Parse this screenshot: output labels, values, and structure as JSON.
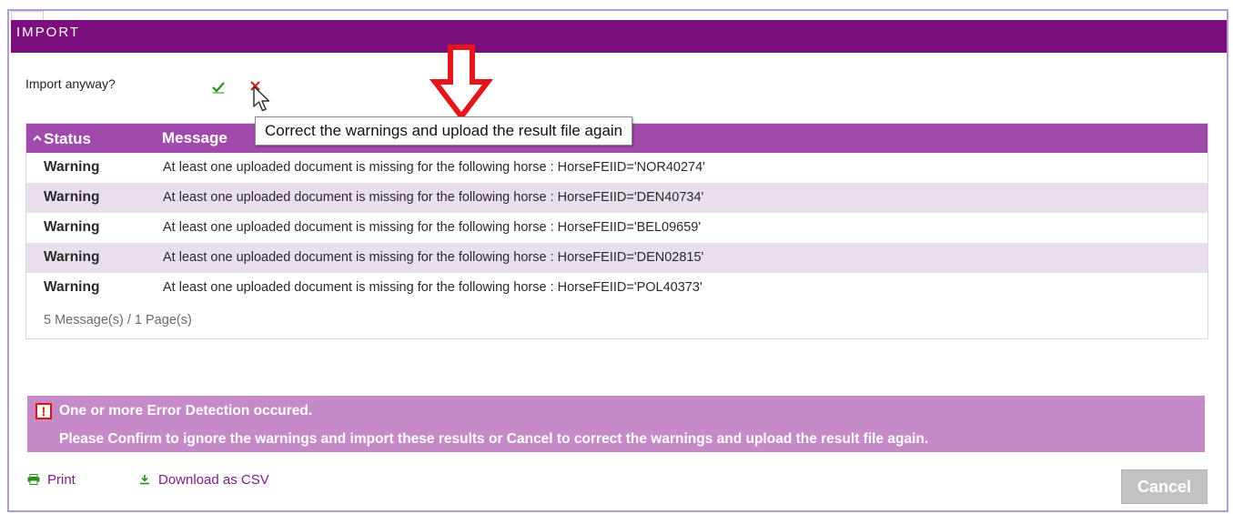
{
  "dialog": {
    "title": "IMPORT"
  },
  "import_prompt": {
    "label": "Import anyway?",
    "confirm_icon": "checkmark-icon",
    "reject_icon": "x-icon"
  },
  "tooltip": {
    "text": "Correct the warnings and upload the result file again"
  },
  "annotation": {
    "icon": "down-arrow-icon",
    "color": "#e3161b"
  },
  "grid": {
    "columns": [
      "Status",
      "Message"
    ],
    "sort_icon": "sort-up-icon",
    "rows": [
      {
        "status": "Warning",
        "message": "At least one uploaded document is missing for the following horse : HorseFEIID='NOR40274'"
      },
      {
        "status": "Warning",
        "message": "At least one uploaded document is missing for the following horse : HorseFEIID='DEN40734'"
      },
      {
        "status": "Warning",
        "message": "At least one uploaded document is missing for the following horse : HorseFEIID='BEL09659'"
      },
      {
        "status": "Warning",
        "message": "At least one uploaded document is missing for the following horse : HorseFEIID='DEN02815'"
      },
      {
        "status": "Warning",
        "message": "At least one uploaded document is missing for the following horse : HorseFEIID='POL40373'"
      }
    ],
    "footer": "5 Message(s) / 1 Page(s)"
  },
  "error_banner": {
    "icon": "exclamation-icon",
    "icon_glyph": "!",
    "line1": "One or more Error Detection occured.",
    "line2": "Please Confirm to ignore the warnings and import these results or Cancel to correct the warnings and upload the result file again."
  },
  "actions": {
    "print_label": "Print",
    "print_icon": "printer-icon",
    "csv_label": "Download as CSV",
    "csv_icon": "download-icon",
    "cancel_label": "Cancel"
  },
  "colors": {
    "title_bar": "#7b0f7e",
    "grid_header": "#a04aab",
    "alt_row": "#e9dfec",
    "banner": "#c58ac7",
    "link": "#7b1f83",
    "confirm": "#2e8b1f",
    "reject": "#d11f1f"
  }
}
